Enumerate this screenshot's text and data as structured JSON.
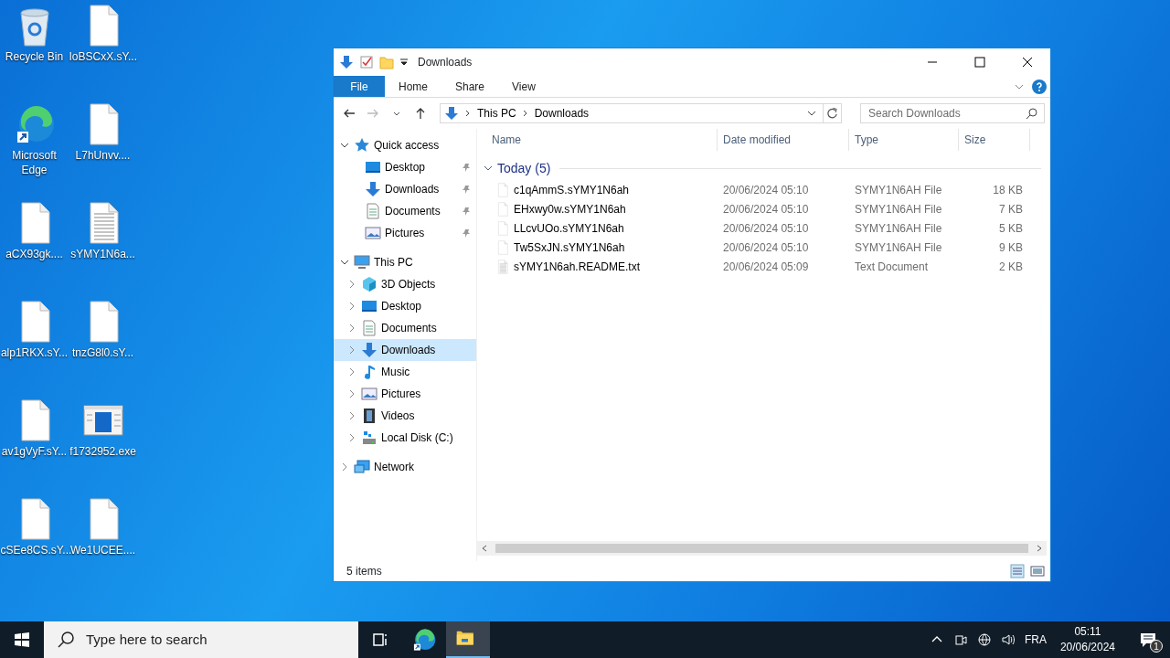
{
  "desktop_icons": [
    {
      "label": "Recycle Bin",
      "kind": "recycle"
    },
    {
      "label": "IoBSCxX.sY...",
      "kind": "file"
    },
    {
      "label": "Microsoft Edge",
      "kind": "edge"
    },
    {
      "label": "L7hUnvv....",
      "kind": "file"
    },
    {
      "label": "aCX93gk....",
      "kind": "file"
    },
    {
      "label": "sYMY1N6a...",
      "kind": "text"
    },
    {
      "label": "alp1RKX.sY...",
      "kind": "file"
    },
    {
      "label": "tnzG8l0.sY...",
      "kind": "file"
    },
    {
      "label": "av1gVyF.sY...",
      "kind": "file"
    },
    {
      "label": "f1732952.exe",
      "kind": "exe"
    },
    {
      "label": "cSEe8CS.sY...",
      "kind": "file"
    },
    {
      "label": "We1UCEE....",
      "kind": "file"
    }
  ],
  "window": {
    "title": "Downloads",
    "ribbon_tabs": [
      {
        "label": "File",
        "kind": "menu",
        "selected": false
      },
      {
        "label": "Home",
        "kind": "tab",
        "selected": false
      },
      {
        "label": "Share",
        "kind": "tab",
        "selected": false
      },
      {
        "label": "View",
        "kind": "tab",
        "selected": false
      }
    ],
    "address": {
      "crumbs": [
        "This PC",
        "Downloads"
      ]
    },
    "search": {
      "placeholder": "Search Downloads"
    },
    "nav": [
      {
        "label": "Quick access",
        "kind": "star",
        "expanded": true,
        "selected": false,
        "children": [
          {
            "label": "Desktop",
            "kind": "desktop",
            "pinned": true,
            "selected": false
          },
          {
            "label": "Downloads",
            "kind": "download",
            "pinned": true,
            "selected": false
          },
          {
            "label": "Documents",
            "kind": "doc",
            "pinned": true,
            "selected": false
          },
          {
            "label": "Pictures",
            "kind": "pictures",
            "pinned": true,
            "selected": false
          }
        ]
      },
      {
        "label": "This PC",
        "kind": "pc",
        "expanded": true,
        "selected": false,
        "children": [
          {
            "label": "3D Objects",
            "kind": "cube",
            "expanded": false,
            "selected": false
          },
          {
            "label": "Desktop",
            "kind": "desktop",
            "expanded": false,
            "selected": false
          },
          {
            "label": "Documents",
            "kind": "doc",
            "expanded": false,
            "selected": false
          },
          {
            "label": "Downloads",
            "kind": "download",
            "expanded": false,
            "selected": true
          },
          {
            "label": "Music",
            "kind": "music",
            "expanded": false,
            "selected": false
          },
          {
            "label": "Pictures",
            "kind": "pictures",
            "expanded": false,
            "selected": false
          },
          {
            "label": "Videos",
            "kind": "video",
            "expanded": false,
            "selected": false
          },
          {
            "label": "Local Disk (C:)",
            "kind": "disk",
            "expanded": false,
            "selected": false
          }
        ]
      },
      {
        "label": "Network",
        "kind": "network",
        "expanded": false,
        "selected": false
      }
    ],
    "columns": [
      "Name",
      "Date modified",
      "Type",
      "Size"
    ],
    "group": {
      "label": "Today (5)",
      "expanded": true
    },
    "rows": [
      {
        "name": "c1qAmmS.sYMY1N6ah",
        "date": "20/06/2024 05:10",
        "type": "SYMY1N6AH File",
        "size": "18 KB",
        "kind": "file"
      },
      {
        "name": "EHxwy0w.sYMY1N6ah",
        "date": "20/06/2024 05:10",
        "type": "SYMY1N6AH File",
        "size": "7 KB",
        "kind": "file"
      },
      {
        "name": "LLcvUOo.sYMY1N6ah",
        "date": "20/06/2024 05:10",
        "type": "SYMY1N6AH File",
        "size": "5 KB",
        "kind": "file"
      },
      {
        "name": "Tw5SxJN.sYMY1N6ah",
        "date": "20/06/2024 05:10",
        "type": "SYMY1N6AH File",
        "size": "9 KB",
        "kind": "file"
      },
      {
        "name": "sYMY1N6ah.README.txt",
        "date": "20/06/2024 05:09",
        "type": "Text Document",
        "size": "2 KB",
        "kind": "text"
      }
    ],
    "status_bar": "5 items"
  },
  "taskbar": {
    "search": {
      "placeholder": "Type here to search"
    },
    "apps": [
      {
        "kind": "taskview",
        "active": false
      },
      {
        "kind": "edge",
        "active": false
      },
      {
        "kind": "explorer",
        "active": true
      }
    ],
    "language": "FRA",
    "time": "05:11",
    "date": "20/06/2024",
    "notifications": "1"
  }
}
